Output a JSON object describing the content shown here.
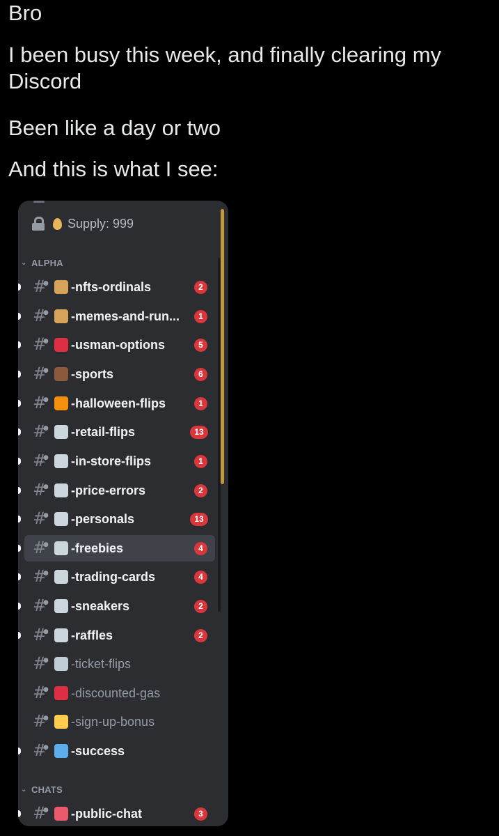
{
  "post": {
    "line1": "Bro",
    "line2": "I been busy this week, and finally clearing my Discord",
    "line3": "Been like a day or two",
    "line4": "And this is what I see:"
  },
  "discord": {
    "supply_label": "Supply: 999",
    "categories": [
      {
        "label": "ALPHA"
      },
      {
        "label": "CHATS"
      }
    ],
    "channels": [
      {
        "name": "-nfts-ordinals",
        "badge": "2",
        "unread": true,
        "emoji": "broom-icon",
        "color": "#d7a35b"
      },
      {
        "name": "-memes-and-run...",
        "badge": "1",
        "unread": true,
        "emoji": "broom-icon",
        "color": "#d7a35b"
      },
      {
        "name": "-usman-options",
        "badge": "5",
        "unread": true,
        "emoji": "phone-icon",
        "color": "#dd2e44"
      },
      {
        "name": "-sports",
        "badge": "6",
        "unread": true,
        "emoji": "football-icon",
        "color": "#8b5a3c"
      },
      {
        "name": "-halloween-flips",
        "badge": "1",
        "unread": true,
        "emoji": "pumpkin-icon",
        "color": "#f4900c"
      },
      {
        "name": "-retail-flips",
        "badge": "13",
        "unread": true,
        "emoji": "sneaker-icon",
        "color": "#ccd6dd"
      },
      {
        "name": "-in-store-flips",
        "badge": "1",
        "unread": true,
        "emoji": "sneaker-icon",
        "color": "#ccd6dd"
      },
      {
        "name": "-price-errors",
        "badge": "2",
        "unread": true,
        "emoji": "sneaker-icon",
        "color": "#ccd6dd"
      },
      {
        "name": "-personals",
        "badge": "13",
        "unread": true,
        "emoji": "sneaker-icon",
        "color": "#ccd6dd"
      },
      {
        "name": "-freebies",
        "badge": "4",
        "unread": true,
        "emoji": "sneaker-icon",
        "color": "#ccd6dd",
        "selected": true
      },
      {
        "name": "-trading-cards",
        "badge": "4",
        "unread": true,
        "emoji": "sneaker-icon",
        "color": "#ccd6dd"
      },
      {
        "name": "-sneakers",
        "badge": "2",
        "unread": true,
        "emoji": "sneaker-icon",
        "color": "#ccd6dd"
      },
      {
        "name": "-raffles",
        "badge": "2",
        "unread": true,
        "emoji": "sneaker-icon",
        "color": "#ccd6dd"
      },
      {
        "name": "-ticket-flips",
        "badge": "",
        "unread": false,
        "emoji": "ticket-icon",
        "color": "#c1cdd6"
      },
      {
        "name": "-discounted-gas",
        "badge": "",
        "unread": false,
        "emoji": "fuel-pump-icon",
        "color": "#dd2e44"
      },
      {
        "name": "-sign-up-bonus",
        "badge": "",
        "unread": false,
        "emoji": "writing-hand-icon",
        "color": "#ffcc4d"
      },
      {
        "name": "-success",
        "badge": "",
        "unread": true,
        "emoji": "chart-increasing-icon",
        "color": "#5dadec"
      },
      {
        "name": "-public-chat",
        "badge": "3",
        "unread": true,
        "emoji": "woman-icon",
        "color": "#ea596e"
      }
    ]
  }
}
